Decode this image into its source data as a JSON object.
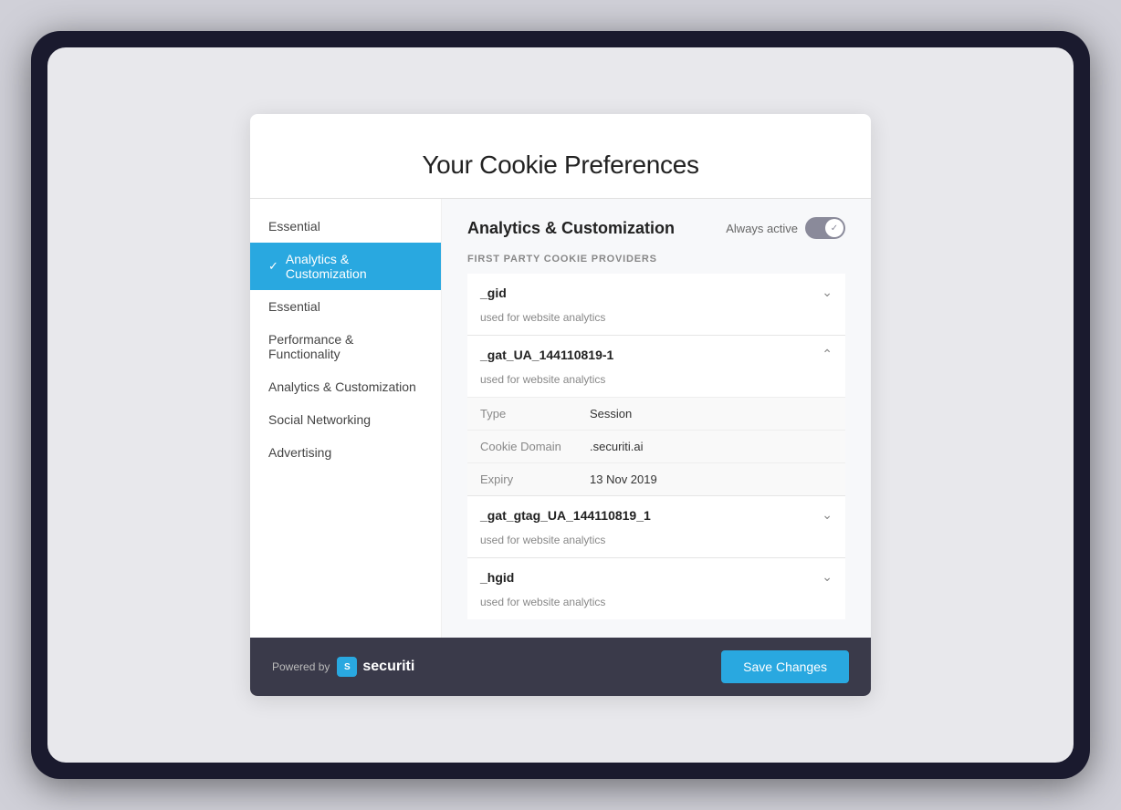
{
  "title": "Your Cookie Preferences",
  "sidebar": {
    "items": [
      {
        "id": "essential-top",
        "label": "Essential",
        "active": false
      },
      {
        "id": "analytics-customization",
        "label": "Analytics & Customization",
        "active": true
      },
      {
        "id": "essential",
        "label": "Essential",
        "active": false
      },
      {
        "id": "performance-functionality",
        "label": "Performance & Functionality",
        "active": false
      },
      {
        "id": "analytics-customization-2",
        "label": "Analytics & Customization",
        "active": false
      },
      {
        "id": "social-networking",
        "label": "Social Networking",
        "active": false
      },
      {
        "id": "advertising",
        "label": "Advertising",
        "active": false
      }
    ]
  },
  "content": {
    "title": "Analytics & Customization",
    "always_active_label": "Always active",
    "section_label": "FIRST PARTY COOKIE PROVIDERS",
    "cookies": [
      {
        "name": "_gid",
        "description": "used for website analytics",
        "expanded": false,
        "details": []
      },
      {
        "name": "_gat_UA_144110819-1",
        "description": "used for website analytics",
        "expanded": true,
        "details": [
          {
            "key": "Type",
            "value": "Session"
          },
          {
            "key": "Cookie Domain",
            "value": ".securiti.ai"
          },
          {
            "key": "Expiry",
            "value": "13 Nov 2019"
          }
        ]
      },
      {
        "name": "_gat_gtag_UA_144110819_1",
        "description": "used for website analytics",
        "expanded": false,
        "details": []
      },
      {
        "name": "_hgid",
        "description": "used for website analytics",
        "expanded": false,
        "details": []
      }
    ]
  },
  "footer": {
    "powered_by": "Powered by",
    "logo_text": "securiti",
    "save_button_label": "Save Changes"
  },
  "icons": {
    "check": "✓",
    "chevron_down": "⌄",
    "chevron_up": "⌃",
    "toggle_check": "✓"
  }
}
